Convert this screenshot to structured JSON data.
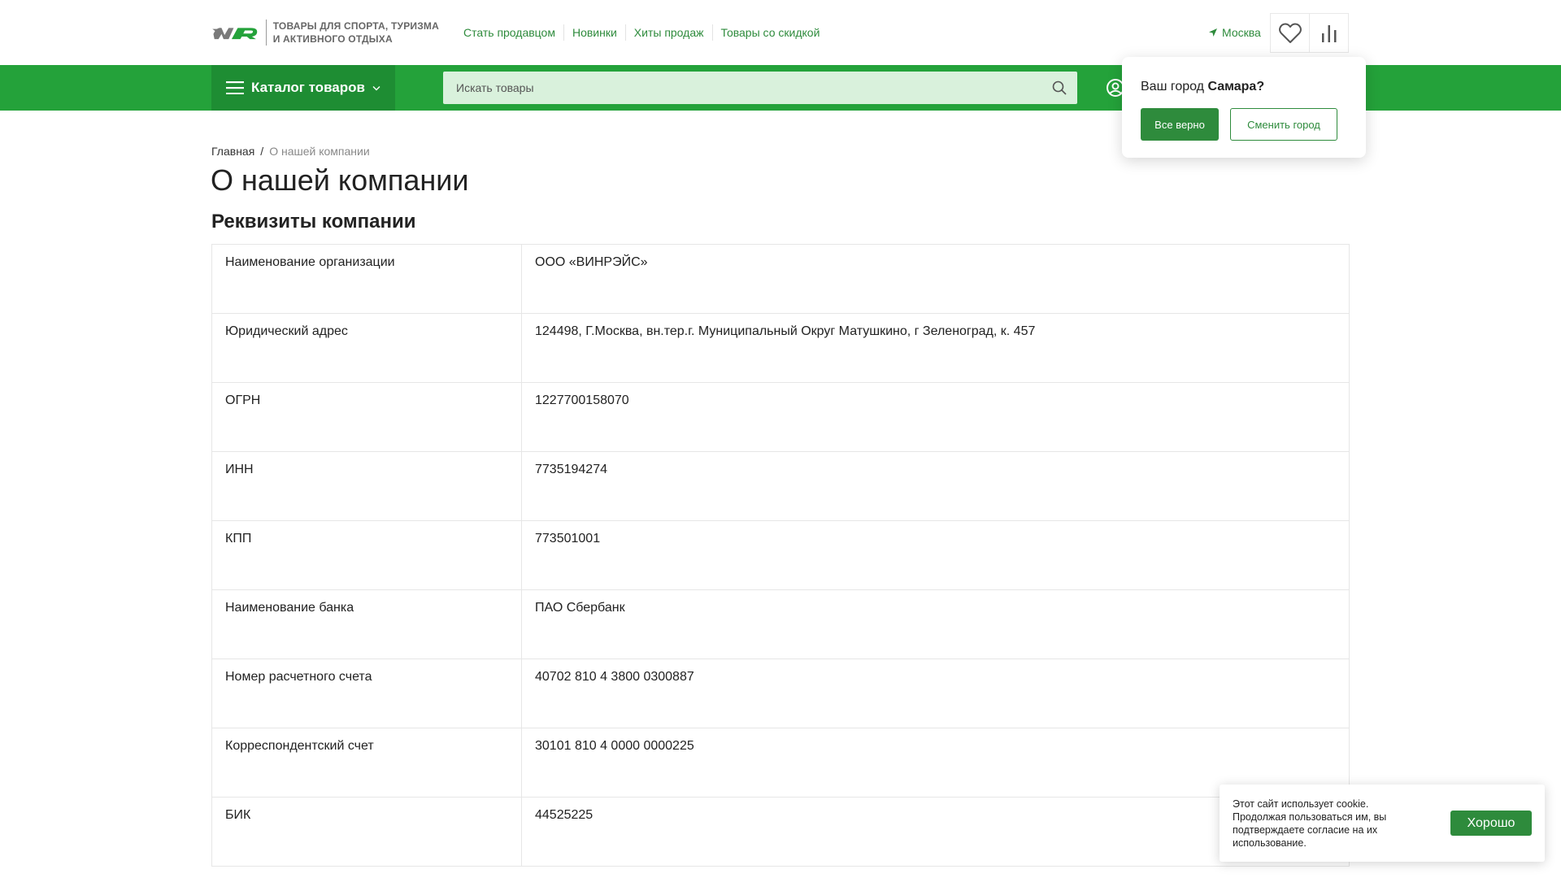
{
  "header": {
    "logo_alt": "WR",
    "logo_tagline_line1": "ТОВАРЫ ДЛЯ СПОРТА, ТУРИЗМА",
    "logo_tagline_line2": "И АКТИВНОГО ОТДЫХА",
    "nav": [
      {
        "label": "Стать продавцом"
      },
      {
        "label": "Новинки"
      },
      {
        "label": "Хиты продаж"
      },
      {
        "label": "Товары со скидкой"
      }
    ],
    "city": "Москва",
    "accent_color": "#2e8b3c",
    "bar_color": "#24a23a"
  },
  "catalog": {
    "label": "Каталог товаров"
  },
  "search": {
    "placeholder": "Искать товары"
  },
  "city_popup": {
    "question_prefix": "Ваш город",
    "city_name": "Самара?",
    "confirm_label": "Все верно",
    "change_label": "Сменить город"
  },
  "breadcrumb": {
    "home": "Главная",
    "separator": "/",
    "current": "О нашей компании"
  },
  "page": {
    "title": "О нашей компании",
    "section_title": "Реквизиты компании"
  },
  "requisites": [
    {
      "key": "Наименование организации",
      "value": "ООО «ВИНРЭЙС»"
    },
    {
      "key": "Юридический адрес",
      "value": "124498, Г.Москва, вн.тер.г. Муниципальный Округ Матушкино, г Зеленоград, к. 457"
    },
    {
      "key": "ОГРН",
      "value": "1227700158070"
    },
    {
      "key": "ИНН",
      "value": "7735194274"
    },
    {
      "key": "КПП",
      "value": "773501001"
    },
    {
      "key": "Наименование банка",
      "value": "ПАО Сбербанк"
    },
    {
      "key": "Номер расчетного счета",
      "value": "40702 810 4 3800 0300887"
    },
    {
      "key": "Корреспондентский счет",
      "value": "30101 810 4 0000 0000225"
    },
    {
      "key": "БИК",
      "value": "44525225"
    }
  ],
  "cookie": {
    "text": "Этот сайт использует cookie. Продолжая пользоваться им, вы подтверждаете согласие на их использование.",
    "button_label": "Хорошо"
  }
}
